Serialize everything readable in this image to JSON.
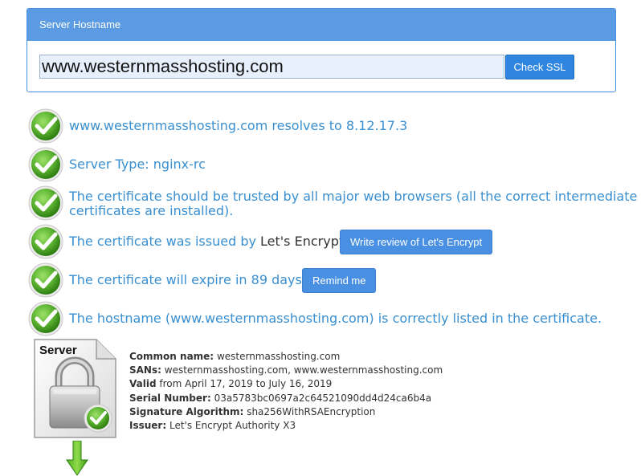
{
  "form": {
    "header": "Server Hostname",
    "hostname_value": "www.westernmasshosting.com",
    "check_button": "Check SSL"
  },
  "results": {
    "resolves": "www.westernmasshosting.com resolves to 8.12.17.3",
    "server_type": "Server Type: nginx-rc",
    "trusted_line1": "The certificate should be trusted by all major web browsers (all the correct intermediate",
    "trusted_line2": "certificates are installed).",
    "issued_prefix": "The certificate was issued by ",
    "issuer_name": "Let's Encrypt",
    "issued_suffix": ".",
    "review_button": "Write review of Let's Encrypt",
    "expire_text": "The certificate will expire in 89 days.",
    "remind_button": "Remind me",
    "hostname_listed": "The hostname (www.westernmasshosting.com) is correctly listed in the certificate."
  },
  "certificate": {
    "icon_label": "Server",
    "fields": [
      {
        "label": "Common name:",
        "value": "westernmasshosting.com"
      },
      {
        "label": "SANs:",
        "value": "westernmasshosting.com, www.westernmasshosting.com"
      },
      {
        "label": "Valid",
        "value": "from April 17, 2019 to July 16, 2019"
      },
      {
        "label": "Serial Number:",
        "value": "03a5783bc0697a2c64521090dd4d24ca6b4a"
      },
      {
        "label": "Signature Algorithm:",
        "value": "sha256WithRSAEncryption"
      },
      {
        "label": "Issuer:",
        "value": "Let's Encrypt Authority X3"
      }
    ]
  },
  "icons": {
    "check": "check-circle-icon",
    "certificate": "server-certificate-lock-icon",
    "arrow": "arrow-down-icon"
  },
  "colors": {
    "accent": "#4a90e2",
    "result_text": "#3a8fd0",
    "check_green": "#5cb531"
  }
}
